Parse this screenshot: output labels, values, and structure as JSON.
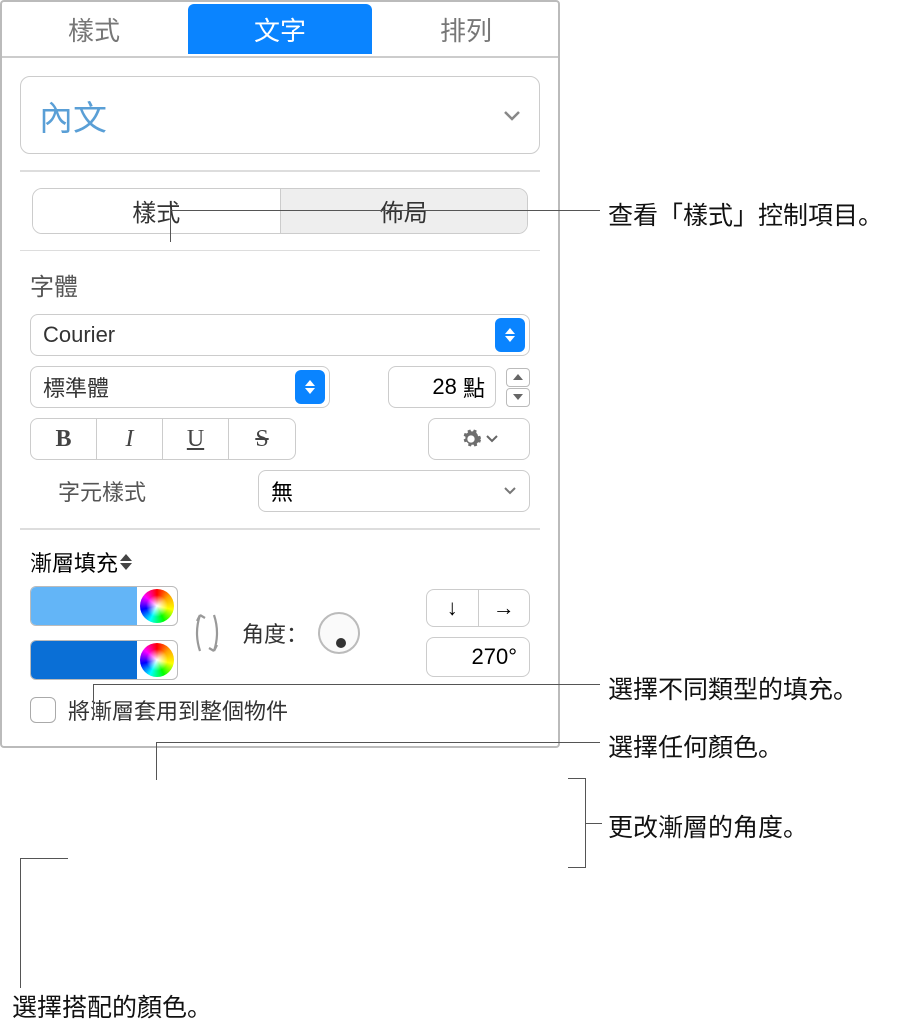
{
  "top_tabs": {
    "style": "樣式",
    "text": "文字",
    "arrange": "排列"
  },
  "paragraph_style": "內文",
  "segmented": {
    "style": "樣式",
    "layout": "佈局"
  },
  "font_section": {
    "label": "字體",
    "family": "Courier",
    "typeface": "標準體",
    "size_value": "28",
    "size_unit": "點",
    "bold": "B",
    "italic": "I",
    "underline": "U",
    "strike": "S",
    "char_style_label": "字元樣式",
    "char_style_value": "無"
  },
  "fill": {
    "type": "漸層填充",
    "angle_label": "角度：",
    "angle_value": "270°",
    "apply_label": "將漸層套用到整個物件",
    "color1": "#63b5f7",
    "color2": "#0a6fd6"
  },
  "callouts": {
    "c1": "查看「樣式」控制項目。",
    "c2": "選擇不同類型的填充。",
    "c3": "選擇任何顏色。",
    "c4": "更改漸層的角度。",
    "c5": "選擇搭配的顏色。"
  }
}
